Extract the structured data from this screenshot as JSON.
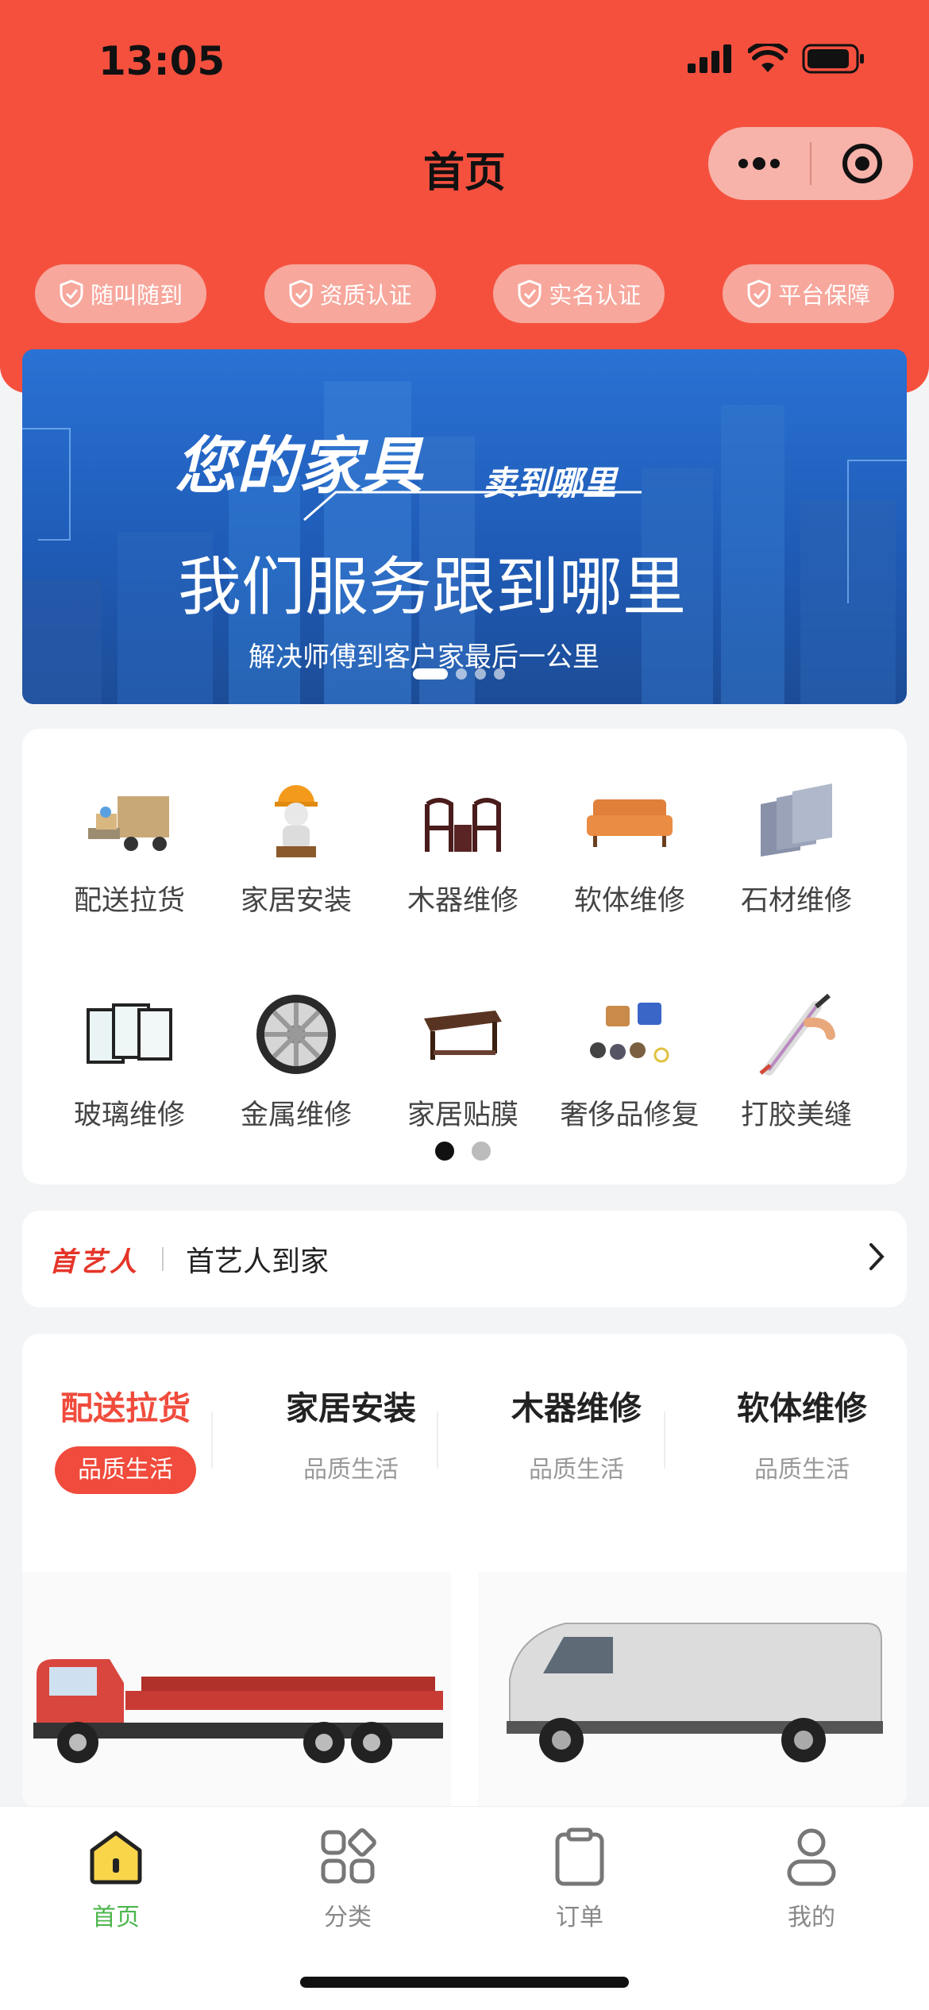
{
  "status_bar": {
    "time": "13:05"
  },
  "header": {
    "title": "首页",
    "badges": [
      "随叫随到",
      "资质认证",
      "实名认证",
      "平台保障"
    ]
  },
  "banner": {
    "line1": "您的家具",
    "line1_sub": "卖到哪里",
    "line2": "我们服务跟到哪里",
    "line3": "解决师傅到客户家最后一公里",
    "dot_count": 4,
    "active_dot": 0
  },
  "categories": [
    {
      "label": "配送拉货",
      "icon": "delivery-truck-icon"
    },
    {
      "label": "家居安装",
      "icon": "installer-worker-icon"
    },
    {
      "label": "木器维修",
      "icon": "wooden-chairs-icon"
    },
    {
      "label": "软体维修",
      "icon": "sofa-icon"
    },
    {
      "label": "石材维修",
      "icon": "stone-slabs-icon"
    },
    {
      "label": "玻璃维修",
      "icon": "glass-panes-icon"
    },
    {
      "label": "金属维修",
      "icon": "metal-wheel-icon"
    },
    {
      "label": "家居贴膜",
      "icon": "coffee-table-icon"
    },
    {
      "label": "奢侈品修复",
      "icon": "luxury-goods-icon"
    },
    {
      "label": "打胶美缝",
      "icon": "caulk-gun-icon"
    }
  ],
  "grid_pages": {
    "count": 2,
    "active": 0
  },
  "notice": {
    "logo": "首艺人",
    "text": "首艺人到家"
  },
  "service_tabs": [
    {
      "title": "配送拉货",
      "sub": "品质生活",
      "active": true
    },
    {
      "title": "家居安装",
      "sub": "品质生活",
      "active": false
    },
    {
      "title": "木器维修",
      "sub": "品质生活",
      "active": false
    },
    {
      "title": "软体维修",
      "sub": "品质生活",
      "active": false
    }
  ],
  "bottom_nav": [
    {
      "label": "首页",
      "icon": "home-icon",
      "active": true
    },
    {
      "label": "分类",
      "icon": "category-icon",
      "active": false
    },
    {
      "label": "订单",
      "icon": "order-clipboard-icon",
      "active": false
    },
    {
      "label": "我的",
      "icon": "profile-icon",
      "active": false
    }
  ],
  "colors": {
    "brand_red": "#f5503e",
    "active_green": "#4cb64c",
    "tab_red": "#f04b3c"
  }
}
